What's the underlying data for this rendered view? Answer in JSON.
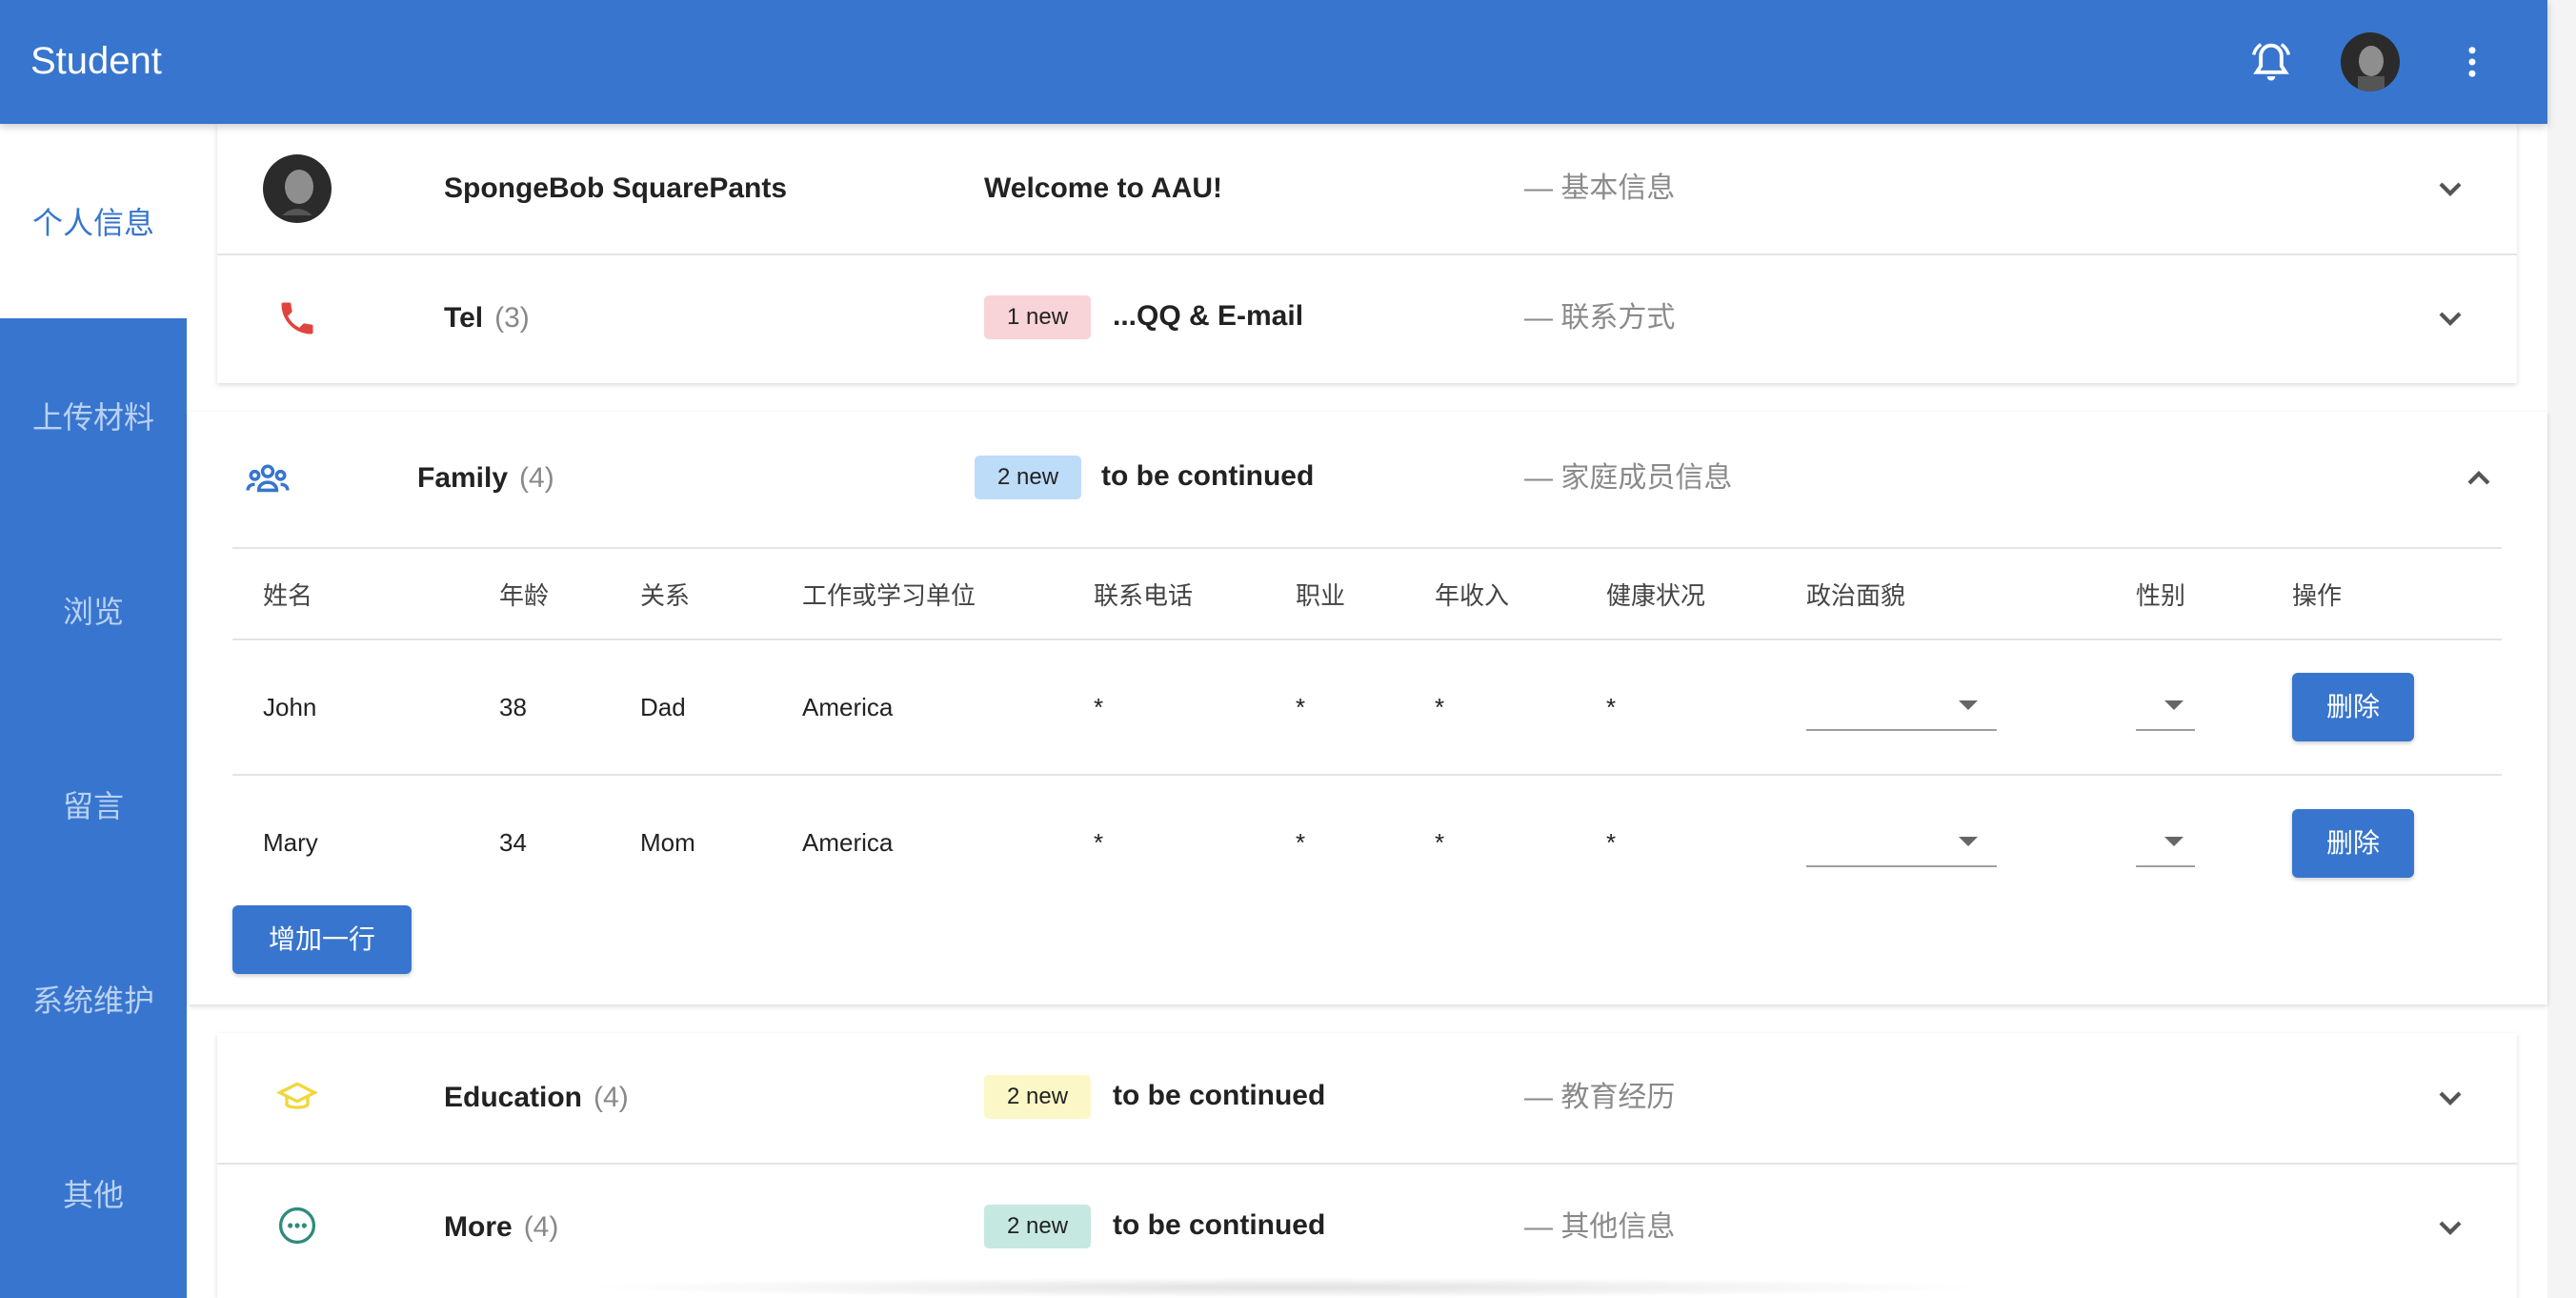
{
  "header": {
    "title": "Student",
    "bell_icon": "bell-icon",
    "more_icon": "more-vert-icon"
  },
  "sidebar": {
    "items": [
      {
        "label": "个人信息",
        "active": true
      },
      {
        "label": "上传材料"
      },
      {
        "label": "浏览"
      },
      {
        "label": "留言"
      },
      {
        "label": "系统维护"
      },
      {
        "label": "其他"
      }
    ]
  },
  "sections": {
    "basic": {
      "name": "SpongeBob SquarePants",
      "message": "Welcome to AAU!",
      "desc": "— 基本信息"
    },
    "tel": {
      "name": "Tel",
      "count": "(3)",
      "badge": "1 new",
      "message": "...QQ & E-mail",
      "desc": "— 联系方式",
      "icon": "phone-icon"
    },
    "family": {
      "name": "Family",
      "count": "(4)",
      "badge": "2 new",
      "message": "to be continued",
      "desc": "— 家庭成员信息",
      "icon": "people-icon"
    },
    "education": {
      "name": "Education",
      "count": "(4)",
      "badge": "2 new",
      "message": "to be continued",
      "desc": "— 教育经历",
      "icon": "graduation-cap-icon"
    },
    "more": {
      "name": "More",
      "count": "(4)",
      "badge": "2 new",
      "message": "to be continued",
      "desc": "— 其他信息",
      "icon": "more-circle-icon"
    }
  },
  "family_table": {
    "headers": [
      "姓名",
      "年龄",
      "关系",
      "工作或学习单位",
      "联系电话",
      "职业",
      "年收入",
      "健康状况",
      "政治面貌",
      "性别",
      "操作"
    ],
    "rows": [
      {
        "name": "John",
        "age": "38",
        "relation": "Dad",
        "unit": "America",
        "phone": "*",
        "job": "*",
        "income": "*",
        "health": "*",
        "political": "",
        "gender": "",
        "action": "删除"
      },
      {
        "name": "Mary",
        "age": "34",
        "relation": "Mom",
        "unit": "America",
        "phone": "*",
        "job": "*",
        "income": "*",
        "health": "*",
        "political": "",
        "gender": "",
        "action": "删除"
      }
    ],
    "add_row_label": "增加一行"
  },
  "colors": {
    "primary": "#3875ce",
    "tel_badge": "#f8d3d7",
    "family_badge": "#bcdcf8",
    "edu_badge": "#fbf7c6",
    "more_badge": "#c5e8e0",
    "phone_icon": "#e0443e",
    "cap_icon": "#f0d73a",
    "more_icon_color": "#2e8b7a"
  }
}
